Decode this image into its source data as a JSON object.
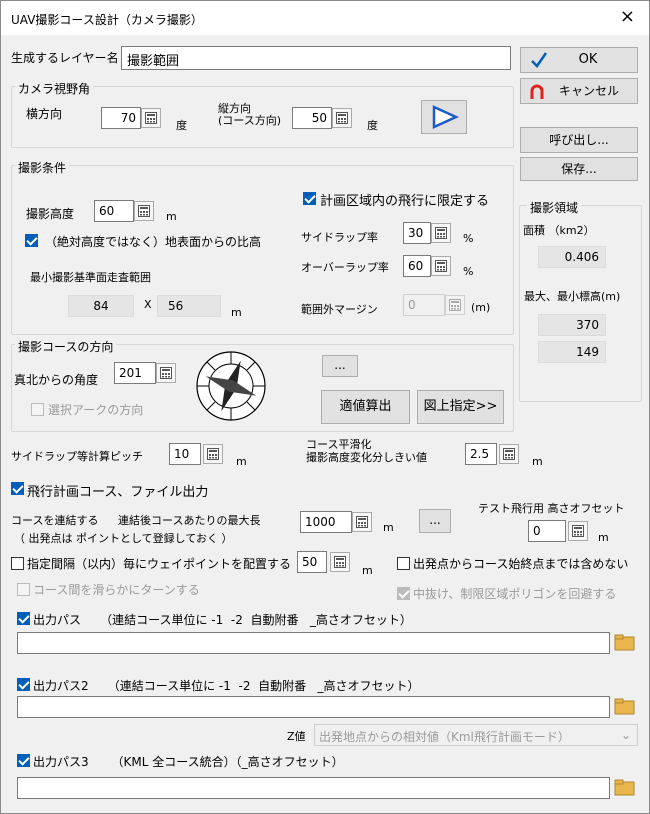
{
  "window": {
    "title": "UAV撮影コース設計（カメラ撮影）",
    "close_glyph": "×"
  },
  "layer": {
    "label": "生成するレイヤー名",
    "value": "撮影範囲"
  },
  "camera": {
    "group": "カメラ視野角",
    "horizontal_label": "横方向",
    "horizontal_value": "70",
    "horizontal_unit": "度",
    "vertical_label_1": "縦方向",
    "vertical_label_2": "(コース方向)",
    "vertical_value": "50",
    "vertical_unit": "度"
  },
  "conditions": {
    "group": "撮影条件",
    "altitude_label": "撮影高度",
    "altitude_value": "60",
    "altitude_unit": "m",
    "ground_ratio_label": "（絶対高度ではなく）地表面からの比高",
    "min_range_label": "最小撮影基準面走査範囲",
    "range_x": "84",
    "range_sep": "X",
    "range_y": "56",
    "range_unit": "m",
    "limit_label": "計画区域内の飛行に限定する",
    "sidelap_label": "サイドラップ率",
    "sidelap_value": "30",
    "sidelap_unit": "%",
    "overlap_label": "オーバーラップ率",
    "overlap_value": "60",
    "overlap_unit": "%",
    "margin_label": "範囲外マージン",
    "margin_value": "0",
    "margin_unit": "(m)"
  },
  "direction": {
    "group": "撮影コースの方向",
    "angle_label": "真北からの角度",
    "angle_value": "201",
    "arc_label": "選択アークの方向",
    "dots_label": "...",
    "calc_button": "適値算出",
    "map_button": "図上指定>>"
  },
  "pitch": {
    "label": "サイドラップ等計算ピッチ",
    "value": "10",
    "unit": "m"
  },
  "smoothing": {
    "label_1": "コース平滑化",
    "label_2": "撮影高度変化分しきい値",
    "value": "2.5",
    "unit": "m"
  },
  "output": {
    "main_label": "飛行計画コース、ファイル出力",
    "connect_label": "コースを連結する",
    "maxlen_label": "連結後コースあたりの最大長",
    "start_note": "（ 出発点は  ポイントとして登録しておく ）",
    "maxlen_value": "1000",
    "maxlen_unit": "m",
    "dots_label": "...",
    "test_offset_label": "テスト飛行用  高さオフセット",
    "test_offset_value": "0",
    "test_offset_unit": "m",
    "interval_label": "指定間隔（以内）毎にウェイポイントを配置する",
    "interval_value": "50",
    "interval_unit": "m",
    "exclude_label": "出発点からコース始終点までは含めない",
    "smooth_turn_label": "コース間を滑らかにターンする",
    "avoid_label": "中抜け、制限区域ポリゴンを回避する",
    "path1_label": "出力パス     （連結コース単位に -1  -2  自動附番   _高さオフセット）",
    "path2_label": "出力パス2     （連結コース単位に -1  -2  自動附番   _高さオフセット）",
    "z_label": "Z値",
    "z_value": "出発地点からの相対値（Kml飛行計画モード）",
    "path3_label": "出力パス3      （KML 全コース統合）（_高さオフセット）"
  },
  "side": {
    "ok": "OK",
    "cancel": "キャンセル",
    "recall": "呼び出し...",
    "save": "保存...",
    "area_group": "撮影領域",
    "area_label": "面積 （km2）",
    "area_value": "0.406",
    "maxmin_label": "最大、最小標高(m)",
    "max_value": "370",
    "min_value": "149"
  },
  "colors": {
    "accent": "#005fb8",
    "play": "#1e5bc6",
    "cancel_icon": "#e0241b",
    "folder": "#e8b64c"
  }
}
